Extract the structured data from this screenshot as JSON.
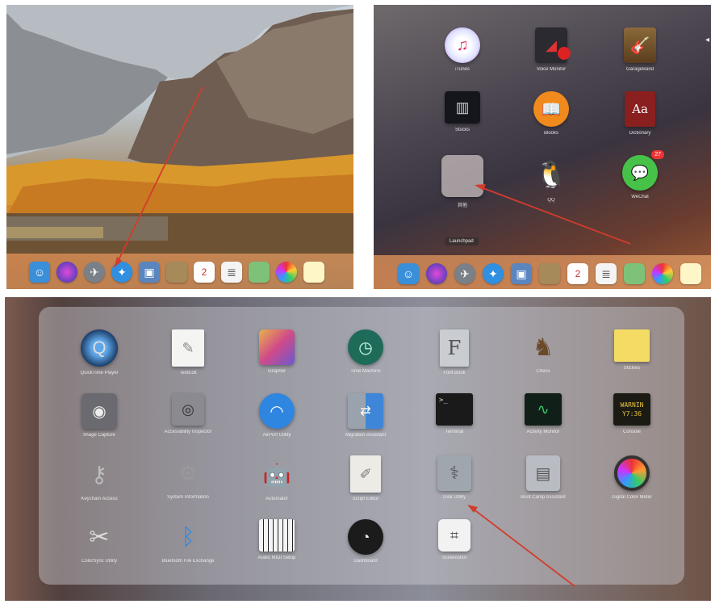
{
  "colors": {
    "arrow": "#d23c2c"
  },
  "panel_desktop": {
    "dock_icons": [
      "finder-icon",
      "siri-icon",
      "launchpad-icon",
      "safari-icon",
      "photos-icon",
      "notes-icon",
      "calendar-icon",
      "reminders-icon",
      "maps-icon",
      "photos-color-icon",
      "stickies-icon"
    ],
    "calendar_day": "2"
  },
  "panel_launchpad": {
    "apps": [
      {
        "label": "iTunes",
        "icon": "itunes-icon"
      },
      {
        "label": "Voice Monitor",
        "icon": "voice-monitor-icon"
      },
      {
        "label": "GarageBand",
        "icon": "garageband-icon"
      },
      {
        "label": "Stocks",
        "icon": "stocks-icon"
      },
      {
        "label": "iBooks",
        "icon": "ibooks-icon"
      },
      {
        "label": "Dictionary",
        "icon": "dictionary-icon"
      },
      {
        "label": "其他",
        "icon": "other-folder-icon"
      },
      {
        "label": "QQ",
        "icon": "qq-icon"
      },
      {
        "label": "WeChat",
        "icon": "wechat-icon"
      }
    ],
    "dictionary_glyph": "Aa",
    "wechat_badge": "27",
    "tooltip": "Launchpad",
    "dock_icons": [
      "finder-icon",
      "siri-icon",
      "launchpad-icon",
      "safari-icon",
      "photos-icon",
      "notes-icon",
      "calendar-icon",
      "reminders-icon",
      "maps-icon",
      "photos-color-icon",
      "stickies-icon"
    ],
    "calendar_day": "2"
  },
  "panel_other_folder": {
    "apps": [
      {
        "label": "QuickTime Player",
        "icon": "quicktime-icon"
      },
      {
        "label": "TextEdit",
        "icon": "textedit-icon"
      },
      {
        "label": "Grapher",
        "icon": "grapher-icon"
      },
      {
        "label": "Time Machine",
        "icon": "time-machine-icon"
      },
      {
        "label": "Font Book",
        "icon": "font-book-icon"
      },
      {
        "label": "Chess",
        "icon": "chess-icon"
      },
      {
        "label": "Stickies",
        "icon": "stickies-icon"
      },
      {
        "label": "Image Capture",
        "icon": "image-capture-icon"
      },
      {
        "label": "Accessibility Inspector",
        "icon": "accessibility-inspector-icon"
      },
      {
        "label": "AirPort Utility",
        "icon": "airport-utility-icon"
      },
      {
        "label": "Migration Assistant",
        "icon": "migration-assistant-icon"
      },
      {
        "label": "Terminal",
        "icon": "terminal-icon"
      },
      {
        "label": "Activity Monitor",
        "icon": "activity-monitor-icon"
      },
      {
        "label": "Console",
        "icon": "console-icon"
      },
      {
        "label": "Keychain Access",
        "icon": "keychain-access-icon"
      },
      {
        "label": "System Information",
        "icon": "system-information-icon"
      },
      {
        "label": "Automator",
        "icon": "automator-icon"
      },
      {
        "label": "Script Editor",
        "icon": "script-editor-icon"
      },
      {
        "label": "Disk Utility",
        "icon": "disk-utility-icon"
      },
      {
        "label": "Boot Camp Assistant",
        "icon": "boot-camp-icon"
      },
      {
        "label": "Digital Color Meter",
        "icon": "digital-color-meter-icon"
      },
      {
        "label": "ColorSync Utility",
        "icon": "colorsync-utility-icon"
      },
      {
        "label": "Bluetooth File Exchange",
        "icon": "bluetooth-file-exchange-icon"
      },
      {
        "label": "Audio MIDI Setup",
        "icon": "audio-midi-icon"
      },
      {
        "label": "Dashboard",
        "icon": "dashboard-icon"
      },
      {
        "label": "Screenshot",
        "icon": "screenshot-icon"
      }
    ],
    "font_glyph": "F",
    "terminal_prompt": ">_",
    "console_text": "WARNIN\nY7:36"
  }
}
